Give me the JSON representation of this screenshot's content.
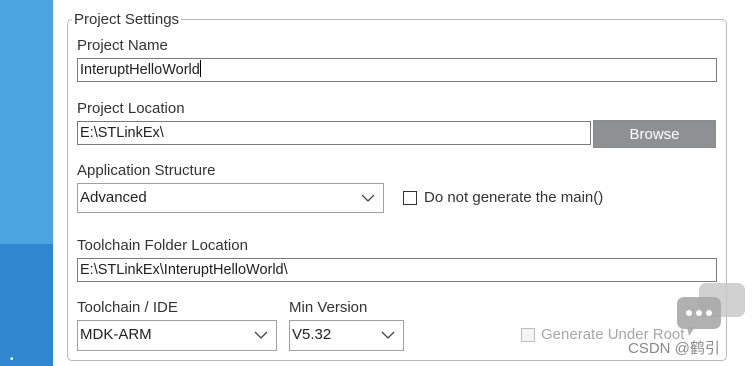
{
  "group": {
    "title": "Project Settings"
  },
  "project_name": {
    "label": "Project Name",
    "value": "InteruptHelloWorld"
  },
  "project_location": {
    "label": "Project Location",
    "value": "E:\\STLinkEx\\",
    "browse_label": "Browse"
  },
  "application_structure": {
    "label": "Application Structure",
    "selected": "Advanced",
    "do_not_generate_main": {
      "label": "Do not generate the main()",
      "checked": false
    }
  },
  "toolchain_folder": {
    "label": "Toolchain Folder Location",
    "value": "E:\\STLinkEx\\InteruptHelloWorld\\"
  },
  "toolchain_ide": {
    "label": "Toolchain / IDE",
    "selected": "MDK-ARM"
  },
  "min_version": {
    "label": "Min Version",
    "selected": "V5.32"
  },
  "generate_under_root": {
    "label": "Generate Under Root",
    "checked": false,
    "enabled": false
  },
  "watermark": {
    "text": "CSDN @鹤引"
  },
  "icons": [
    "chevron-down-icon",
    "chat-bubble-icon",
    "checkbox-icon"
  ],
  "colors": {
    "sidebar_light": "#4ba3df",
    "sidebar_dark": "#2f87cf",
    "browse_button": "#8f9093",
    "group_border": "#b9b9b9"
  }
}
